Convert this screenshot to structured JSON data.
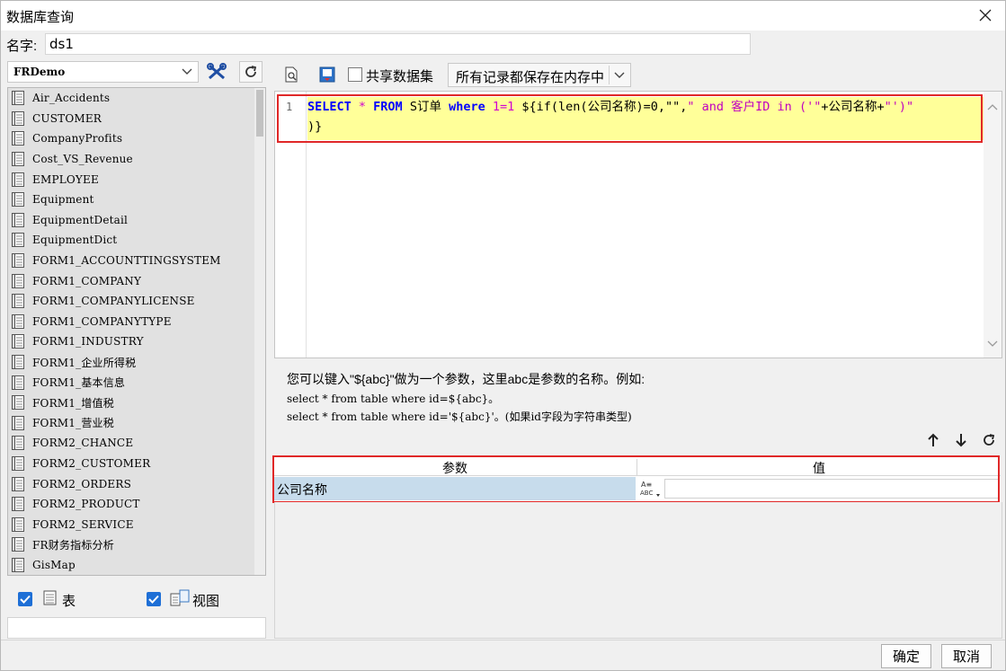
{
  "window": {
    "title": "数据库查询"
  },
  "name_field": {
    "label": "名字:",
    "value": "ds1"
  },
  "left": {
    "datasource": "FRDemo",
    "tables": [
      "Air_Accidents",
      "CUSTOMER",
      "CompanyProfits",
      "Cost_VS_Revenue",
      "EMPLOYEE",
      "Equipment",
      "EquipmentDetail",
      "EquipmentDict",
      "FORM1_ACCOUNTTINGSYSTEM",
      "FORM1_COMPANY",
      "FORM1_COMPANYLICENSE",
      "FORM1_COMPANYTYPE",
      "FORM1_INDUSTRY",
      "FORM1_企业所得税",
      "FORM1_基本信息",
      "FORM1_增值税",
      "FORM1_营业税",
      "FORM2_CHANCE",
      "FORM2_CUSTOMER",
      "FORM2_ORDERS",
      "FORM2_PRODUCT",
      "FORM2_SERVICE",
      "FR财务指标分析",
      "GisMap"
    ],
    "opt_table": "表",
    "opt_view": "视图"
  },
  "right": {
    "share_label": "共享数据集",
    "memory_option": "所有记录都保存在内存中",
    "sql": {
      "line_number": "1",
      "t1": "SELECT",
      "t2": " * ",
      "t3": "FROM",
      "t4": " S订单 ",
      "t5": "where",
      "t6": " 1=1",
      "t7": " ${if(len(公司名称)=0,\"\",",
      "t8": "\" and 客户ID in ('\"",
      "t9": "+公司名称+",
      "t10": "\"')\"",
      "line2": ")}"
    },
    "hint": {
      "line1": "您可以键入\"${abc}\"做为一个参数，这里abc是参数的名称。例如:",
      "line2": "select * from table where id=${abc}。",
      "line3": "select * from table where id='${abc}'。(如果id字段为字符串类型)"
    },
    "param_table": {
      "col_param": "参数",
      "col_value": "值",
      "row_name": "公司名称",
      "row_value": ""
    }
  },
  "buttons": {
    "ok": "确定",
    "cancel": "取消"
  }
}
